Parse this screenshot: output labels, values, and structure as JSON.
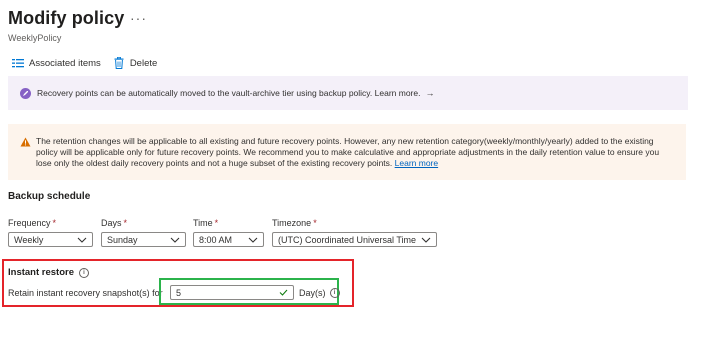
{
  "header": {
    "title": "Modify policy",
    "more": "···",
    "subtitle": "WeeklyPolicy"
  },
  "toolbar": {
    "associated_label": "Associated items",
    "delete_label": "Delete"
  },
  "info_banner": {
    "text": "Recovery points can be automatically moved to the vault-archive tier using backup policy. Learn more.",
    "arrow": "→",
    "color": "#8661c5"
  },
  "warning_banner": {
    "text": "The retention changes will be applicable to all existing and future recovery points. However, any new retention category(weekly/monthly/yearly) added to the existing policy will be applicable only for future recovery points. We recommend you to make calculative and appropriate adjustments in the daily retention value to ensure you lose only the oldest daily recovery points and not a huge subset of the existing recovery points.",
    "link": "Learn more",
    "color": "#d86e00"
  },
  "schedule": {
    "heading": "Backup schedule",
    "required_mark": "*",
    "frequency": {
      "label": "Frequency",
      "value": "Weekly"
    },
    "days": {
      "label": "Days",
      "value": "Sunday"
    },
    "time": {
      "label": "Time",
      "value": "8:00 AM"
    },
    "timezone": {
      "label": "Timezone",
      "value": "(UTC) Coordinated Universal Time"
    }
  },
  "instant_restore": {
    "heading": "Instant restore",
    "label": "Retain instant recovery snapshot(s) for",
    "value": "5",
    "unit": "Day(s)",
    "info_glyph": "i"
  },
  "highlight": {
    "red": "#e4242a",
    "green": "#2bb34b"
  }
}
